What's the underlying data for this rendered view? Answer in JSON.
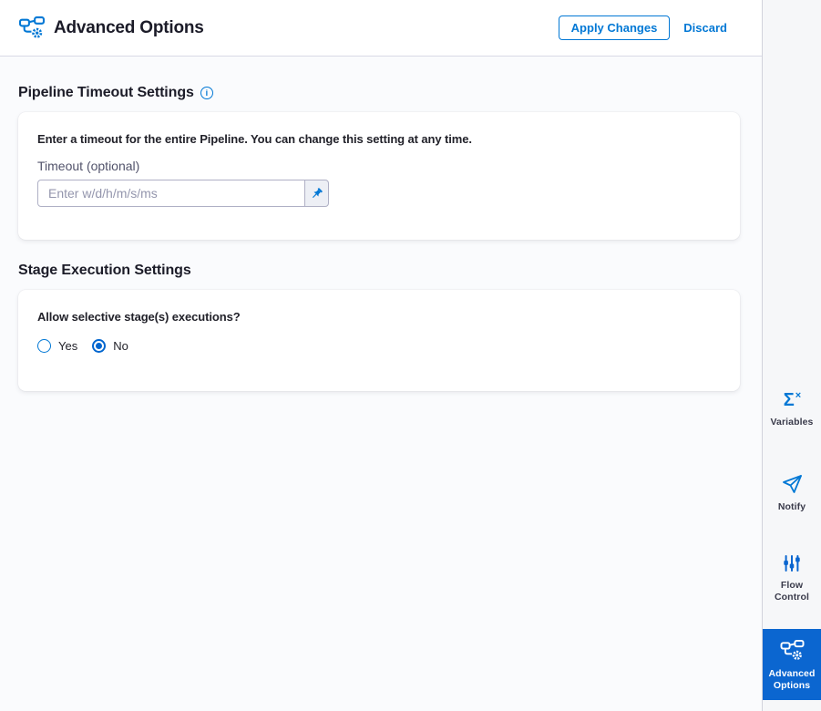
{
  "header": {
    "title": "Advanced Options",
    "apply_label": "Apply Changes",
    "discard_label": "Discard"
  },
  "pipeline_timeout": {
    "heading": "Pipeline Timeout Settings",
    "info_icon": "info-icon",
    "description": "Enter a timeout for the entire Pipeline. You can change this setting at any time.",
    "timeout_label": "Timeout (optional)",
    "timeout_placeholder": "Enter w/d/h/m/s/ms",
    "timeout_value": "",
    "pin_icon": "pin-icon"
  },
  "stage_execution": {
    "heading": "Stage Execution Settings",
    "question": "Allow selective stage(s) executions?",
    "options": [
      {
        "label": "Yes",
        "selected": false
      },
      {
        "label": "No",
        "selected": true
      }
    ]
  },
  "sidebar": {
    "items": [
      {
        "label_lines": [
          "Variables"
        ],
        "icon": "sigma-x-icon",
        "active": false
      },
      {
        "label_lines": [
          "Notify"
        ],
        "icon": "paper-plane-icon",
        "active": false
      },
      {
        "label_lines": [
          "Flow",
          "Control"
        ],
        "icon": "sliders-icon",
        "active": false
      },
      {
        "label_lines": [
          "Advanced",
          "Options"
        ],
        "icon": "pipeline-gear-icon",
        "active": true
      }
    ]
  },
  "colors": {
    "accent": "#0278d5",
    "active_tile": "#0b66d0",
    "text_dark": "#1c1c28"
  }
}
